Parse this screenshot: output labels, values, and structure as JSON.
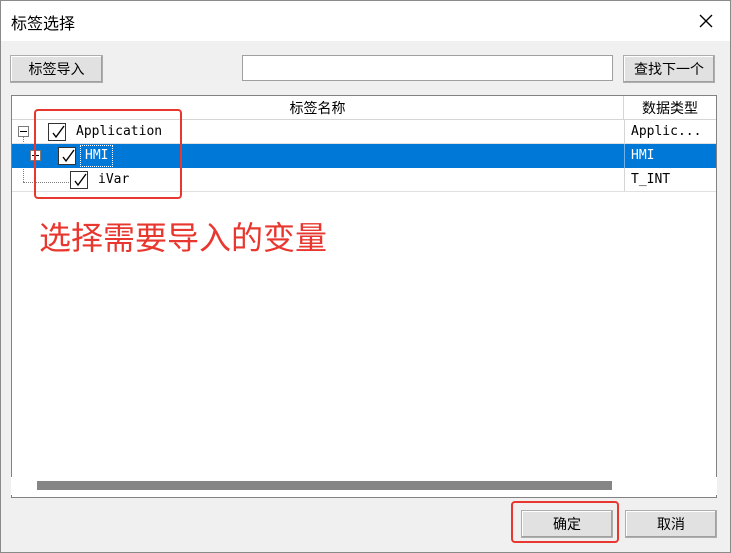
{
  "window": {
    "title": "标签选择"
  },
  "toolbar": {
    "import_label": "标签导入",
    "search_value": "",
    "search_placeholder": "",
    "find_next_label": "查找下一个"
  },
  "table": {
    "headers": {
      "name": "标签名称",
      "type": "数据类型"
    },
    "rows": [
      {
        "name": "Application",
        "type": "Applic...",
        "checked": true,
        "level": 0,
        "selected": false
      },
      {
        "name": "HMI",
        "type": "HMI",
        "checked": true,
        "level": 1,
        "selected": true
      },
      {
        "name": "iVar",
        "type": "T_INT",
        "checked": true,
        "level": 2,
        "selected": false
      }
    ]
  },
  "annotation": {
    "text": "选择需要导入的变量"
  },
  "footer": {
    "ok_label": "确定",
    "cancel_label": "取消"
  },
  "colors": {
    "selection": "#0078d7",
    "annotation": "#e8372e"
  },
  "icons": {
    "close": "close-icon",
    "check": "check-icon",
    "expander": "minus-box-icon"
  }
}
